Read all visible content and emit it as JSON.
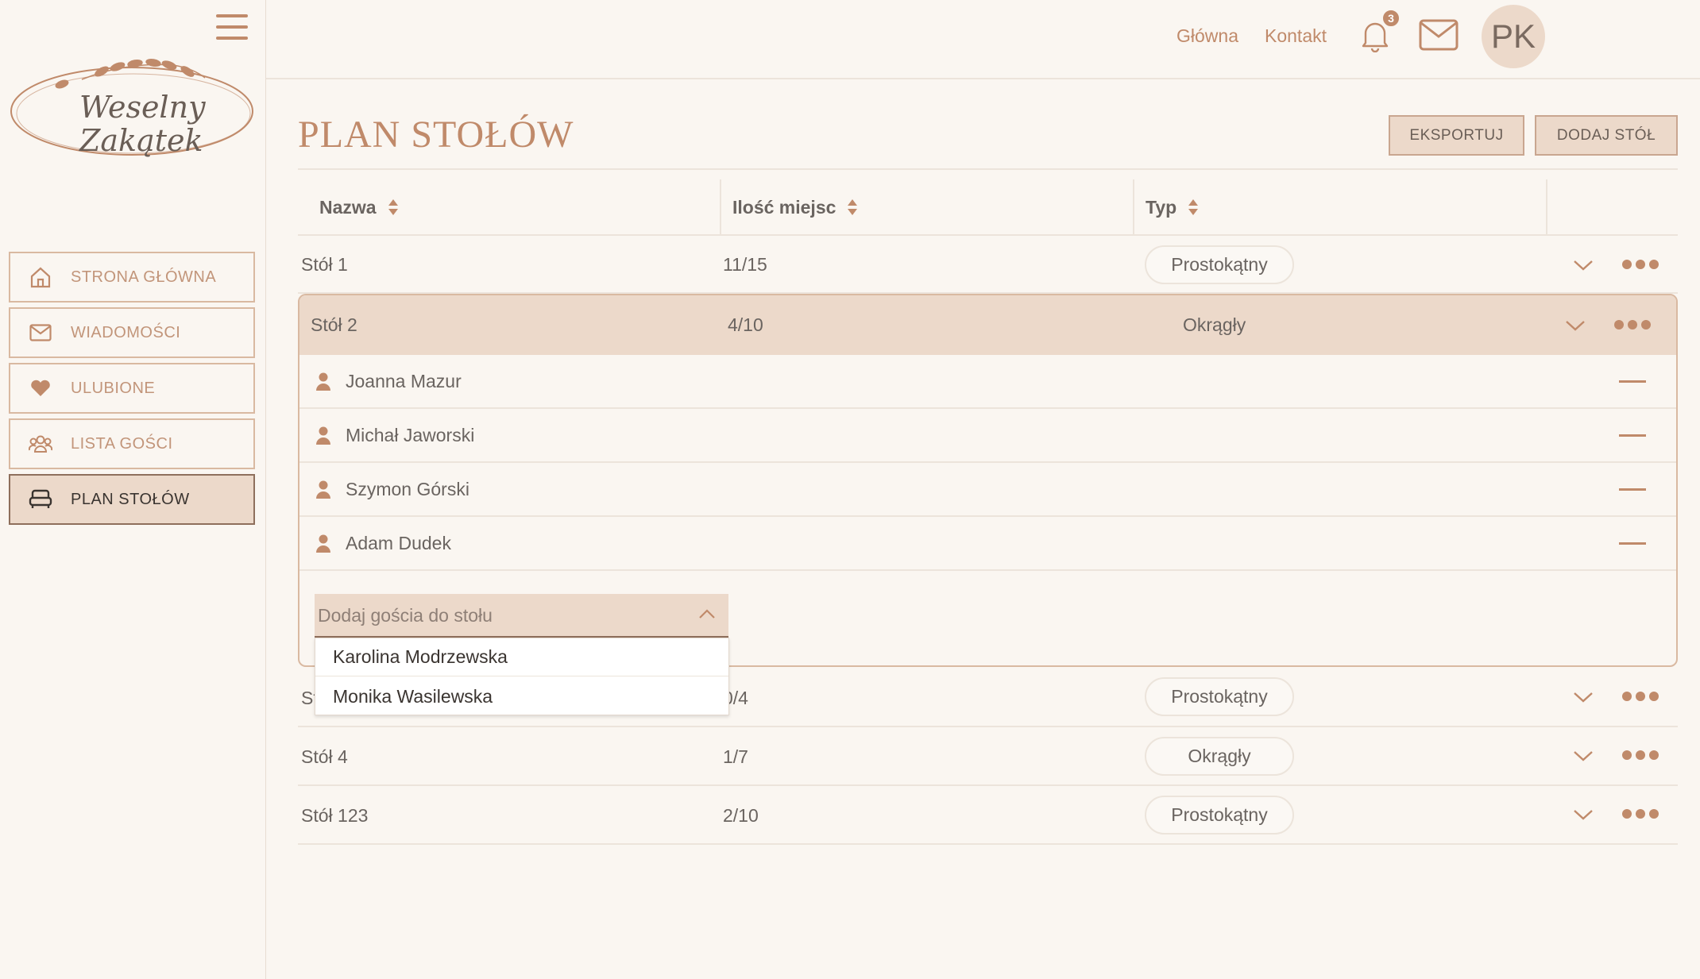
{
  "brand": {
    "logo_line1": "Weselny",
    "logo_line2": "Zakątek"
  },
  "sidebar": {
    "items": [
      {
        "label": "STRONA GŁÓWNA",
        "icon": "home-icon"
      },
      {
        "label": "WIADOMOŚCI",
        "icon": "mail-icon"
      },
      {
        "label": "ULUBIONE",
        "icon": "heart-icon"
      },
      {
        "label": "LISTA GOŚCI",
        "icon": "users-icon"
      },
      {
        "label": "PLAN STOŁÓW",
        "icon": "sofa-icon",
        "active": true
      }
    ]
  },
  "topbar": {
    "links": [
      "Główna",
      "Kontakt"
    ],
    "notifications": "3",
    "avatar_initials": "PK"
  },
  "page": {
    "title": "PLAN STOŁÓW",
    "export_label": "EKSPORTUJ",
    "add_table_label": "DODAJ STÓŁ"
  },
  "table": {
    "headers": [
      "Nazwa",
      "Ilość miejsc",
      "Typ"
    ],
    "rows": [
      {
        "name": "Stół 1",
        "seats": "11/15",
        "type": "Prostokątny"
      },
      {
        "name": "Stół 2",
        "seats": "4/10",
        "type": "Okrągły"
      },
      {
        "name": "Stół 3",
        "seats": "0/4",
        "type": "Prostokątny"
      },
      {
        "name": "Stół 4",
        "seats": "1/7",
        "type": "Okrągły"
      },
      {
        "name": "Stół 123",
        "seats": "2/10",
        "type": "Prostokątny"
      }
    ],
    "expanded_guests": [
      "Joanna Mazur",
      "Michał Jaworski",
      "Szymon Górski",
      "Adam Dudek"
    ]
  },
  "add_guest": {
    "placeholder": "Dodaj gościa do stołu",
    "options": [
      "Karolina Modrzewska",
      "Monika Wasilewska"
    ]
  },
  "colors": {
    "accent": "#c08a6a",
    "highlight": "#ecd9ca",
    "background": "#faf6f1"
  }
}
